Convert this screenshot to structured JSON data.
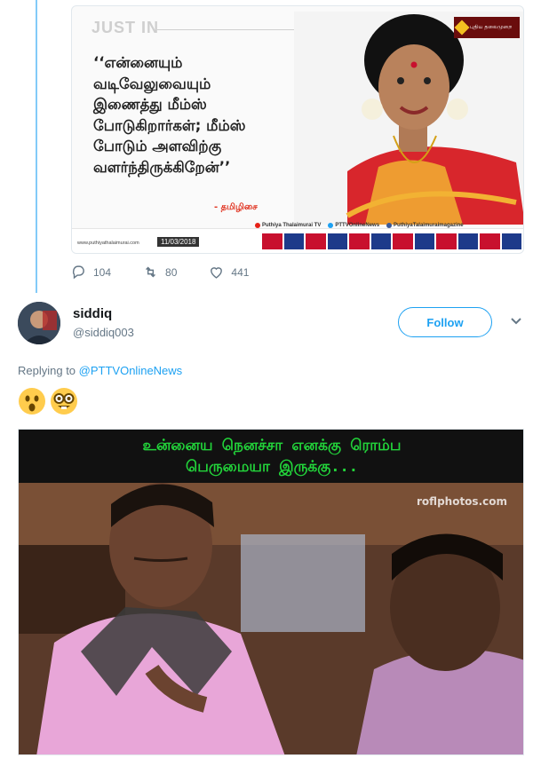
{
  "quoted_card": {
    "label": "JUST IN",
    "quote_lines": [
      "‘‘என்னையும்",
      "வடிவேலுவையும்",
      "இணைத்து மீம்ஸ்",
      "போடுகிறார்கள்; மீம்ஸ்",
      "போடும் அளவிற்கு",
      "வளர்ந்திருக்கிறேன்’’"
    ],
    "source": "- தமிழிசை",
    "logo_text": "புதிய தலைமுறை",
    "website": "www.puthiyathalaimurai.com",
    "date": "11/03/2018",
    "socials": [
      "Puthiya Thalaimurai TV",
      "PTTVOnlineNews",
      "PuthiyaTalaimuraimagazine"
    ]
  },
  "tweet_actions": {
    "replies": "104",
    "retweets": "80",
    "likes": "441"
  },
  "reply": {
    "name": "siddiq",
    "handle": "@siddiq003",
    "follow_label": "Follow",
    "replying_prefix": "Replying to",
    "replying_to": "@PTTVOnlineNews",
    "emojis": [
      "astonished-face",
      "nerd-face"
    ]
  },
  "meme": {
    "caption_lines": [
      "உன்னைய நெனச்சா எனக்கு ரொம்ப",
      "பெருமையா இருக்கு..."
    ],
    "watermark": "roflphotos.com"
  },
  "colors": {
    "accent": "#1da1f2",
    "meme_text": "#22d33a",
    "shirt_pink": "#e8a6d8"
  }
}
